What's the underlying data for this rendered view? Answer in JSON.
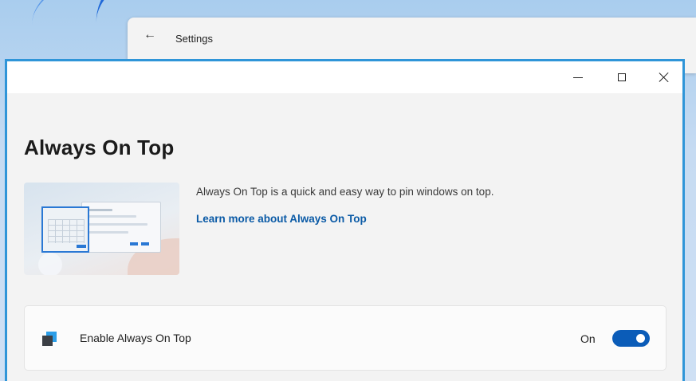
{
  "settings_window": {
    "back_icon": "arrow-left-icon",
    "title": "Settings"
  },
  "titlebar": {
    "minimize_icon": "minimize-icon",
    "maximize_icon": "maximize-icon",
    "close_icon": "close-icon"
  },
  "page": {
    "title": "Always On Top",
    "description": "Always On Top is a quick and easy way to pin windows on top.",
    "learn_more_link": "Learn more about Always On Top"
  },
  "setting": {
    "icon": "always-on-top-icon",
    "label": "Enable Always On Top",
    "state_label": "On",
    "enabled": true
  },
  "colors": {
    "accent": "#0b5cb8",
    "window_border": "#2f95d8",
    "link": "#0a5aa6"
  }
}
